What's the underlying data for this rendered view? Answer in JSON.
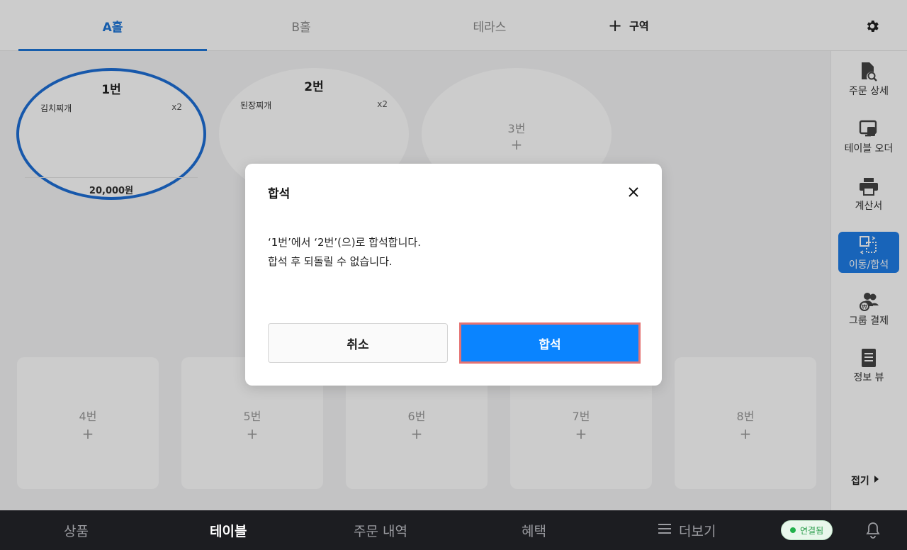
{
  "top_tabs": [
    {
      "label": "A홀",
      "active": true
    },
    {
      "label": "B홀",
      "active": false
    },
    {
      "label": "테라스",
      "active": false
    }
  ],
  "add_zone": {
    "icon": "plus-icon",
    "label": "구역"
  },
  "settings_icon": "gear-icon",
  "tables_top": [
    {
      "name": "1번",
      "item": "김치찌개",
      "qty": "x2",
      "price": "20,000원",
      "selected": true
    },
    {
      "name": "2번",
      "item": "된장찌개",
      "qty": "x2",
      "price": "",
      "selected": false
    },
    {
      "name": "3번",
      "plus": "+"
    }
  ],
  "tables_bottom": [
    {
      "name": "4번",
      "plus": "+"
    },
    {
      "name": "5번",
      "plus": "+"
    },
    {
      "name": "6번",
      "plus": "+"
    },
    {
      "name": "7번",
      "plus": "+"
    },
    {
      "name": "8번",
      "plus": "+"
    }
  ],
  "sidebar": {
    "items": [
      {
        "label": "주문 상세",
        "icon": "order-detail-icon",
        "active": false
      },
      {
        "label": "테이블 오더",
        "icon": "table-order-icon",
        "active": false
      },
      {
        "label": "계산서",
        "icon": "printer-icon",
        "active": false
      },
      {
        "label": "이동/합석",
        "icon": "move-merge-icon",
        "active": true
      },
      {
        "label": "그룹 결제",
        "icon": "group-payment-icon",
        "active": false
      },
      {
        "label": "정보 뷰",
        "icon": "info-view-icon",
        "active": false
      }
    ],
    "collapse_label": "접기"
  },
  "bottom_nav": {
    "items": [
      {
        "label": "상품",
        "active": false
      },
      {
        "label": "테이블",
        "active": true
      },
      {
        "label": "주문 내역",
        "active": false
      },
      {
        "label": "혜택",
        "active": false
      },
      {
        "label": "더보기",
        "active": false
      }
    ],
    "connection_status": "연결됨"
  },
  "dialog": {
    "title": "합석",
    "message_line1": "‘1번’에서 ‘2번’(으)로 합석합니다.",
    "message_line2": "합석 후 되돌릴 수 없습니다.",
    "cancel_label": "취소",
    "confirm_label": "합석"
  },
  "colors": {
    "accent": "#1c75d8",
    "primary_button": "#0a84ff",
    "highlight_border": "#e57373",
    "bottom_bar": "#1c1d21",
    "connected": "#22b14c"
  }
}
